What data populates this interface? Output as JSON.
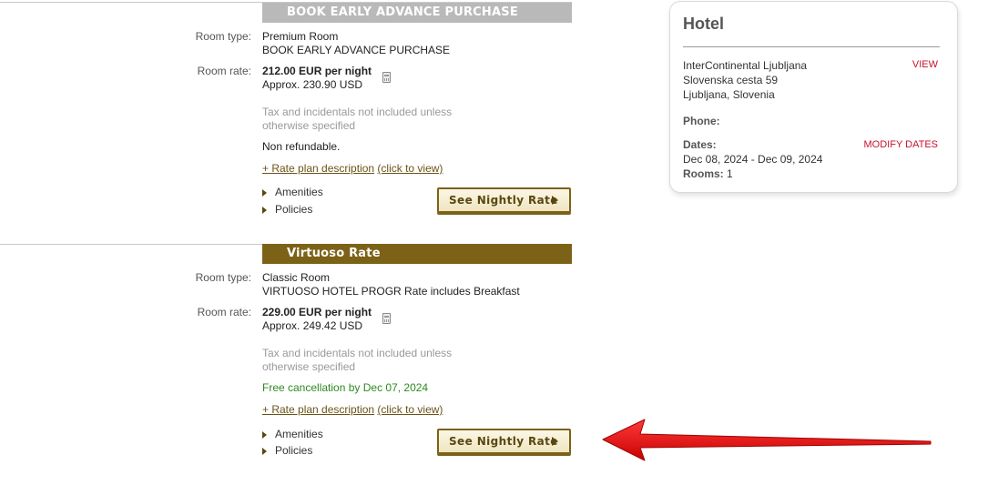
{
  "plans": [
    {
      "header": "BOOK EARLY ADVANCE PURCHASE",
      "room_type_label": "Room type:",
      "room_type": "Premium Room",
      "room_desc": "BOOK EARLY ADVANCE PURCHASE",
      "room_rate_label": "Room rate:",
      "rate": "212.00 EUR per night",
      "approx": "Approx. 230.90 USD",
      "tax_line1": "Tax and incidentals not included unless",
      "tax_line2": "otherwise specified",
      "cancel_policy": "Non refundable.",
      "rate_plan_link": "+ Rate plan description",
      "click_to_view": "(click to view)",
      "amenities": "Amenities",
      "policies": "Policies",
      "nightly_button": "See Nightly Rate"
    },
    {
      "header": "Virtuoso Rate",
      "room_type_label": "Room type:",
      "room_type": "Classic Room",
      "room_desc": "VIRTUOSO HOTEL PROGR Rate includes Breakfast",
      "room_rate_label": "Room rate:",
      "rate": "229.00 EUR per night",
      "approx": "Approx. 249.42 USD",
      "tax_line1": "Tax and incidentals not included unless",
      "tax_line2": "otherwise specified",
      "cancel_policy": "Free cancellation by Dec 07, 2024",
      "rate_plan_link": "+ Rate plan description",
      "click_to_view": "(click to view)",
      "amenities": "Amenities",
      "policies": "Policies",
      "nightly_button": "See Nightly Rate"
    }
  ],
  "hotel_card": {
    "title": "Hotel",
    "name": "InterContinental Ljubljana",
    "street": "Slovenska cesta 59",
    "city": "Ljubljana, Slovenia",
    "view_link": "VIEW",
    "phone_label": "Phone:",
    "dates_label": "Dates:",
    "modify_dates": "MODIFY DATES",
    "dates": "Dec 08, 2024 - Dec 09, 2024",
    "rooms_label": "Rooms:",
    "rooms": "1"
  },
  "colors": {
    "gold": "#7c6217",
    "gray_header": "#b9b9b9",
    "green_cancel": "#2d8a1f",
    "red_link": "#c8102e",
    "arrow_red": "#e01010"
  },
  "icons": [
    "calculator-icon",
    "triangle-right-icon",
    "play-arrow-icon",
    "red-pointer-arrow-icon"
  ]
}
